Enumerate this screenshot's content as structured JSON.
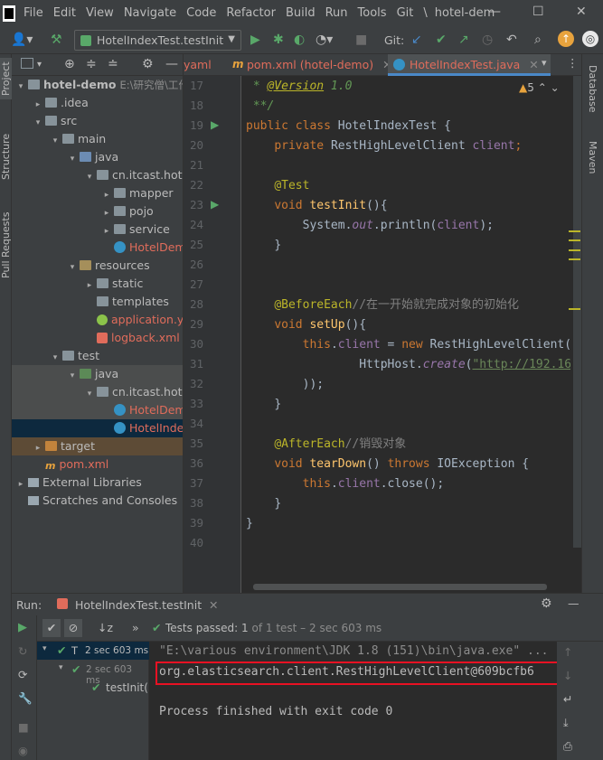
{
  "menubar": {
    "items": [
      "File",
      "Edit",
      "View",
      "Navigate",
      "Code",
      "Refactor",
      "Build",
      "Run",
      "Tools",
      "Git",
      "\\"
    ],
    "project_title": "hotel-dem",
    "minimize": "—",
    "maximize": "☐",
    "close": "✕"
  },
  "toolbar": {
    "run_config": "HotelIndexTest.testInit",
    "git_label": "Git:"
  },
  "left_strip": {
    "project_tab": "Project",
    "structure_tab": "Structure",
    "pull_requests_tab": "Pull Requests"
  },
  "right_strip": {
    "database_tab": "Database",
    "maven_tab": "Maven"
  },
  "project_tree": [
    {
      "label": "hotel-demo",
      "extra": "E:\\研究僧\\工作相关",
      "indent": 0,
      "arrow": "▾",
      "icon": "folder",
      "color": "default",
      "bold": true
    },
    {
      "label": ".idea",
      "indent": 1,
      "arrow": "▸",
      "icon": "folder",
      "color": "default"
    },
    {
      "label": "src",
      "indent": 1,
      "arrow": "▾",
      "icon": "folder",
      "color": "default"
    },
    {
      "label": "main",
      "indent": 2,
      "arrow": "▾",
      "icon": "folder",
      "color": "default"
    },
    {
      "label": "java",
      "indent": 3,
      "arrow": "▾",
      "icon": "folder src",
      "color": "default"
    },
    {
      "label": "cn.itcast.hotel",
      "indent": 4,
      "arrow": "▾",
      "icon": "pkg",
      "color": "default"
    },
    {
      "label": "mapper",
      "indent": 5,
      "arrow": "▸",
      "icon": "pkg",
      "color": "default"
    },
    {
      "label": "pojo",
      "indent": 5,
      "arrow": "▸",
      "icon": "pkg",
      "color": "default"
    },
    {
      "label": "service",
      "indent": 5,
      "arrow": "▸",
      "icon": "pkg",
      "color": "default"
    },
    {
      "label": "HotelDemoApp",
      "indent": 5,
      "arrow": "",
      "icon": "cls",
      "color": "red"
    },
    {
      "label": "resources",
      "indent": 3,
      "arrow": "▾",
      "icon": "folder res",
      "color": "default"
    },
    {
      "label": "static",
      "indent": 4,
      "arrow": "▸",
      "icon": "folder",
      "color": "default"
    },
    {
      "label": "templates",
      "indent": 4,
      "arrow": "",
      "icon": "folder",
      "color": "default"
    },
    {
      "label": "application.yaml",
      "indent": 4,
      "arrow": "",
      "icon": "yml",
      "color": "red"
    },
    {
      "label": "logback.xml",
      "indent": 4,
      "arrow": "",
      "icon": "xml",
      "color": "red"
    },
    {
      "label": "test",
      "indent": 2,
      "arrow": "▾",
      "icon": "folder",
      "color": "default"
    },
    {
      "label": "java",
      "indent": 3,
      "arrow": "▾",
      "icon": "folder test",
      "color": "default",
      "sel": "gray"
    },
    {
      "label": "cn.itcast.hotel",
      "indent": 4,
      "arrow": "▾",
      "icon": "pkg",
      "color": "default",
      "sel": "gray"
    },
    {
      "label": "HotelDemoApp",
      "indent": 5,
      "arrow": "",
      "icon": "cls",
      "color": "red",
      "sel": "gray"
    },
    {
      "label": "HotelIndexTest",
      "indent": 5,
      "arrow": "",
      "icon": "cls",
      "color": "red",
      "sel": "blue"
    },
    {
      "label": "target",
      "indent": 1,
      "arrow": "▸",
      "icon": "folder tgt",
      "color": "default",
      "sel": "target"
    },
    {
      "label": "pom.xml",
      "indent": 1,
      "arrow": "",
      "icon": "mvn",
      "color": "red"
    },
    {
      "label": "External Libraries",
      "indent": 0,
      "arrow": "▸",
      "icon": "lib",
      "color": "default"
    },
    {
      "label": "Scratches and Consoles",
      "indent": 0,
      "arrow": "",
      "icon": "lib",
      "color": "default"
    }
  ],
  "editor_tabs": [
    {
      "label": "yaml",
      "active": false
    },
    {
      "label": "pom.xml (hotel-demo)",
      "active": false
    },
    {
      "label": "HotelIndexTest.java",
      "active": true
    }
  ],
  "editor": {
    "warning_count": "5",
    "line_numbers": [
      "17",
      "18",
      "19",
      "20",
      "21",
      "22",
      "23",
      "24",
      "25",
      "26",
      "27",
      "28",
      "29",
      "30",
      "31",
      "32",
      "33",
      "34",
      "35",
      "36",
      "37",
      "38",
      "39",
      "40"
    ]
  },
  "code": {
    "l17_star": " * ",
    "l17_tag": "@Version",
    "l17_ver": " 1.0",
    "l18": " **/",
    "l19_kw": "public class ",
    "l19_name": "HotelIndexTest {",
    "l20_kw": "private ",
    "l20_type": "RestHighLevelClient ",
    "l20_fld": "client",
    "l20_end": ";",
    "l22_ann": "@Test",
    "l23_kw": "void ",
    "l23_mth": "testInit",
    "l23_end": "(){",
    "l24_pre": "System.",
    "l24_out": "out",
    "l24_mid": ".println(",
    "l24_fld": "client",
    "l24_end": ");",
    "l25": "}",
    "l28_ann": "@BeforeEach",
    "l28_cmt": "//在一开始就完成对象的初始化",
    "l29_kw": "void ",
    "l29_mth": "setUp",
    "l29_end": "(){",
    "l30_this": "this",
    "l30_dot": ".",
    "l30_fld": "client",
    "l30_eq": " = ",
    "l30_new": "new ",
    "l30_cls": "RestHighLevelClient(R",
    "l31_pre": "HttpHost.",
    "l31_create": "create",
    "l31_paren": "(",
    "l31_str": "\"http://192.168",
    "l32": "));",
    "l33": "}",
    "l35_ann": "@AfterEach",
    "l35_cmt": "//销毁对象",
    "l36_kw": "void ",
    "l36_mth": "tearDown",
    "l36_mid": "() ",
    "l36_throws": "throws ",
    "l36_end": "IOException {",
    "l37_this": "this",
    "l37_dot": ".",
    "l37_fld": "client",
    "l37_end": ".close();",
    "l38": "}",
    "l39": "}"
  },
  "run_panel": {
    "run_label": "Run:",
    "tab_label": "HotelIndexTest.testInit",
    "tests_passed_label": "Tests passed: ",
    "tests_passed_count": "1",
    "tests_passed_rest": " of 1 test – 2 sec 603 ms",
    "tree_root_name": "T",
    "tree_root_time": "2 sec 603 ms",
    "tree_child_time": "2 sec 603 ms",
    "tree_leaf": "testInit(",
    "console_lines": [
      "\"E:\\various environment\\JDK 1.8 (151)\\bin\\java.exe\" ...",
      "org.elasticsearch.client.RestHighLevelClient@609bcfb6",
      "",
      "Process finished with exit code 0"
    ]
  },
  "colors": {
    "accent_blue": "#4a88c7",
    "run_green": "#59a869",
    "highlight_red": "#e81123"
  }
}
